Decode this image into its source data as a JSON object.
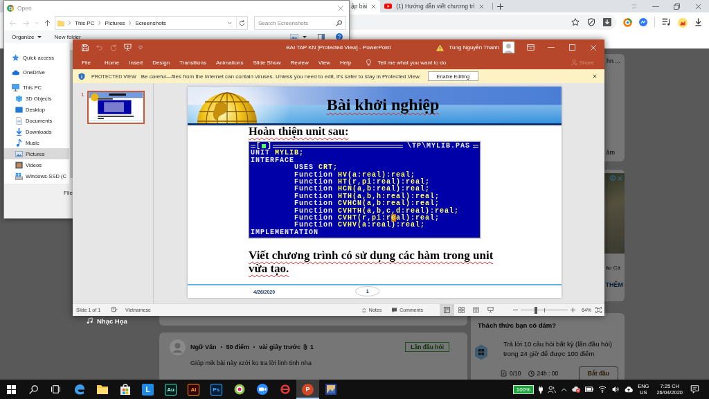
{
  "browser": {
    "tabs": [
      {
        "title": "ập bài",
        "selected": true
      },
      {
        "title": "(1) Hướng dẫn viết chương trì",
        "selected": false
      }
    ],
    "page": {
      "sidebar": {
        "label": "Nhạc Họa"
      },
      "top_card": {
        "text": "hn ...",
        "link": "âm"
      },
      "ad": {
        "caption": "ảo Cá",
        "link": "THÊM"
      },
      "post": {
        "subject": "Ngữ Văn",
        "points": "50 điểm",
        "time": "vài giây trước",
        "attachments": "1",
        "tag": "Lần đầu hỏi",
        "body": "Giúp mik bài này xzới ko tra lời linh tinh nha"
      },
      "challenge": {
        "title": "Thách thức bạn có dám?",
        "text": "Trả lời 10 câu hỏi  bất kỳ (lần đầu hỏi) trong 24 giờ để được 100 điểm",
        "progress": "0/10",
        "timer": "24h : 00",
        "button": "Bắt đầu"
      }
    }
  },
  "open_dialog": {
    "title": "Open",
    "path": [
      "This PC",
      "Pictures",
      "Screenshots"
    ],
    "search": {
      "placeholder": "Search Screenshots"
    },
    "toolbar": [
      {
        "label": "Organize",
        "kind": "menu"
      },
      {
        "label": "New folder",
        "kind": "plain"
      }
    ],
    "nav": [
      {
        "label": "Quick access",
        "selected": false
      },
      {
        "label": "OneDrive",
        "selected": false
      },
      {
        "label": "This PC",
        "selected": false,
        "children": [
          {
            "label": "3D Objects",
            "selected": false
          },
          {
            "label": "Desktop",
            "selected": false
          },
          {
            "label": "Documents",
            "selected": false
          },
          {
            "label": "Downloads",
            "selected": false
          },
          {
            "label": "Music",
            "selected": false
          },
          {
            "label": "Pictures",
            "selected": true
          },
          {
            "label": "Videos",
            "selected": false
          },
          {
            "label": "Windows-SSD (C",
            "selected": false
          }
        ]
      }
    ],
    "file_name_label": "File"
  },
  "powerpoint": {
    "title": "BAI TAP KN [Protected View] - PowerPoint",
    "user": "Tùng Nguyễn Thanh",
    "tabs": [
      {
        "label": "File",
        "selected": false
      },
      {
        "label": "Home",
        "selected": false
      },
      {
        "label": "Insert",
        "selected": false
      },
      {
        "label": "Design",
        "selected": false
      },
      {
        "label": "Transitions",
        "selected": false
      },
      {
        "label": "Animations",
        "selected": false
      },
      {
        "label": "Slide Show",
        "selected": false
      },
      {
        "label": "Review",
        "selected": false
      },
      {
        "label": "View",
        "selected": false
      },
      {
        "label": "Help",
        "selected": false
      }
    ],
    "tell_me": "Tell me what you want to do",
    "share": {
      "label": "Share",
      "disabled": true
    },
    "message_bar": {
      "title": "PROTECTED VIEW",
      "text": "Be careful—files from the Internet can contain viruses. Unless you need to edit, it's safer to stay in Protected View.",
      "button": "Enable Editing"
    },
    "thumbnails": [
      {
        "number": "1",
        "selected": true
      }
    ],
    "slide": {
      "title": {
        "text": "Bài khởi nghiệp",
        "misspelled": true
      },
      "heading": {
        "text": "Hoàn thiện unit sau:",
        "misspelled": true
      },
      "code": {
        "close_box": {
          "left": "[",
          "right": "]"
        },
        "file": "\\TP\\MYLIB.PAS",
        "lines": [
          {
            "parts": [
              {
                "text": "UNIT",
                "kind": "keyword"
              },
              {
                "text": "MYLIB;",
                "kind": "name"
              }
            ]
          },
          {
            "parts": [
              {
                "text": "INTERFACE",
                "kind": "keyword"
              }
            ],
            "children": [
              {
                "parts": [
                  {
                    "text": "USES",
                    "kind": "keyword"
                  },
                  {
                    "text": "CRT;",
                    "kind": "name"
                  }
                ]
              },
              {
                "parts": [
                  {
                    "text": "Function",
                    "kind": "keyword"
                  },
                  {
                    "text": "HV(a:real):real;",
                    "kind": "name"
                  }
                ]
              },
              {
                "parts": [
                  {
                    "text": "Function",
                    "kind": "keyword"
                  },
                  {
                    "text": "HT(r,pi:real):real;",
                    "kind": "name"
                  }
                ]
              },
              {
                "parts": [
                  {
                    "text": "Function",
                    "kind": "keyword"
                  },
                  {
                    "text": "HCN(a,b:real):real;",
                    "kind": "name"
                  }
                ]
              },
              {
                "parts": [
                  {
                    "text": "Function",
                    "kind": "keyword"
                  },
                  {
                    "text": "HTH(a,b,h:real):real;",
                    "kind": "name"
                  }
                ]
              },
              {
                "parts": [
                  {
                    "text": "Function",
                    "kind": "keyword"
                  },
                  {
                    "text": "CVHCN(a,b:real):real;",
                    "kind": "name"
                  }
                ]
              },
              {
                "parts": [
                  {
                    "text": "Function",
                    "kind": "keyword"
                  },
                  {
                    "text": "CVHTH(a,b,c,d:real):real;",
                    "kind": "name"
                  }
                ]
              },
              {
                "parts": [
                  {
                    "text": "Function",
                    "kind": "keyword"
                  },
                  {
                    "text": "CVHT(r,pi:r",
                    "kind": "name"
                  },
                  {
                    "text": "e",
                    "kind": "cursor"
                  },
                  {
                    "text": "al):real;",
                    "kind": "name"
                  }
                ]
              },
              {
                "parts": [
                  {
                    "text": "Function",
                    "kind": "keyword"
                  },
                  {
                    "text": "CVHV(a:real):real;",
                    "kind": "name"
                  }
                ]
              }
            ]
          },
          {
            "parts": [
              {
                "text": "IMPLEMENTATION",
                "kind": "keyword"
              }
            ]
          }
        ]
      },
      "task": {
        "text": "Viết chương trình có sử dụng các hàm trong unit vừa tạo.",
        "misspelled": true
      },
      "date": "4/26/2020",
      "number": "1"
    },
    "status_bar": {
      "position": "Slide 1 of 1",
      "language": "Vietnamese",
      "notes": "Notes",
      "comments": "Comments",
      "views": [
        {
          "selected": true
        },
        {
          "selected": false
        },
        {
          "selected": false
        },
        {
          "selected": false
        }
      ],
      "zoom": {
        "level": 0.33,
        "reading": "64%"
      }
    }
  },
  "taskbar": {
    "apps": [
      {
        "kind": "icon",
        "active": false
      },
      {
        "kind": "icon",
        "active": false
      },
      {
        "kind": "icon",
        "active": false
      },
      {
        "kind": "tile",
        "label": "L",
        "active": false
      },
      {
        "kind": "tile",
        "label": "Au",
        "active": false
      },
      {
        "kind": "tile",
        "label": "Ai",
        "active": false
      },
      {
        "kind": "tile",
        "label": "Ps",
        "active": false
      },
      {
        "kind": "icon",
        "active": false
      },
      {
        "kind": "icon",
        "active": false
      },
      {
        "kind": "icon",
        "active": false
      },
      {
        "kind": "badge",
        "label": "P",
        "active": true
      },
      {
        "kind": "icon",
        "active": false
      }
    ],
    "battery": "100%",
    "language": {
      "name": "ENG",
      "region": "US"
    },
    "clock": {
      "time": "7:25 CH",
      "date": "26/04/2020"
    }
  }
}
